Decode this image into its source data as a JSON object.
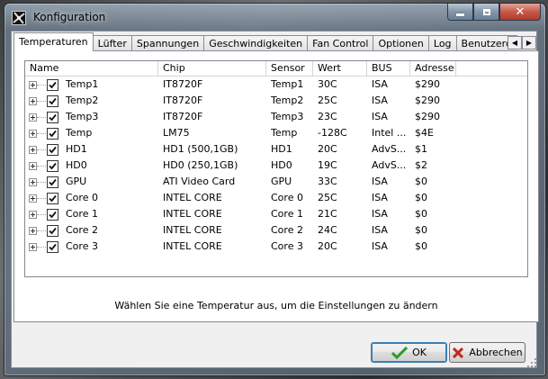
{
  "window": {
    "title": "Konfiguration"
  },
  "tabs": [
    "Temperaturen",
    "Lüfter",
    "Spannungen",
    "Geschwindigkeiten",
    "Fan Control",
    "Optionen",
    "Log",
    "Benutzerdefinier"
  ],
  "columns": [
    "Name",
    "Chip",
    "Sensor",
    "Wert",
    "BUS",
    "Adresse"
  ],
  "rows": [
    {
      "name": "Temp1",
      "chip": "IT8720F",
      "sensor": "Temp1",
      "wert": "30C",
      "bus": "ISA",
      "adresse": "$290"
    },
    {
      "name": "Temp2",
      "chip": "IT8720F",
      "sensor": "Temp2",
      "wert": "25C",
      "bus": "ISA",
      "adresse": "$290"
    },
    {
      "name": "Temp3",
      "chip": "IT8720F",
      "sensor": "Temp3",
      "wert": "23C",
      "bus": "ISA",
      "adresse": "$290"
    },
    {
      "name": "Temp",
      "chip": "LM75",
      "sensor": "Temp",
      "wert": "-128C",
      "bus": "Intel ...",
      "adresse": "$4E"
    },
    {
      "name": "HD1",
      "chip": "HD1 (500,1GB)",
      "sensor": "HD1",
      "wert": "20C",
      "bus": "AdvS...",
      "adresse": "$1"
    },
    {
      "name": "HD0",
      "chip": "HD0 (250,1GB)",
      "sensor": "HD0",
      "wert": "19C",
      "bus": "AdvS...",
      "adresse": "$2"
    },
    {
      "name": "GPU",
      "chip": "ATI Video Card",
      "sensor": "GPU",
      "wert": "33C",
      "bus": "ISA",
      "adresse": "$0"
    },
    {
      "name": "Core 0",
      "chip": "INTEL CORE",
      "sensor": "Core 0",
      "wert": "25C",
      "bus": "ISA",
      "adresse": "$0"
    },
    {
      "name": "Core 1",
      "chip": "INTEL CORE",
      "sensor": "Core 1",
      "wert": "21C",
      "bus": "ISA",
      "adresse": "$0"
    },
    {
      "name": "Core 2",
      "chip": "INTEL CORE",
      "sensor": "Core 2",
      "wert": "24C",
      "bus": "ISA",
      "adresse": "$0"
    },
    {
      "name": "Core 3",
      "chip": "INTEL CORE",
      "sensor": "Core 3",
      "wert": "20C",
      "bus": "ISA",
      "adresse": "$0"
    }
  ],
  "status": "Wählen Sie eine Temperatur aus, um die Einstellungen zu ändern",
  "buttons": {
    "ok": "OK",
    "cancel": "Abbrechen"
  },
  "icons": {
    "ok": "checkmark-icon",
    "cancel": "red-x-icon",
    "expander": "plus-expander-icon",
    "checkbox": "checked-checkbox-icon"
  },
  "colors": {
    "ok_check": "#2e9a2e",
    "cancel_x": "#c0281e",
    "close_button": "#c75a49"
  }
}
